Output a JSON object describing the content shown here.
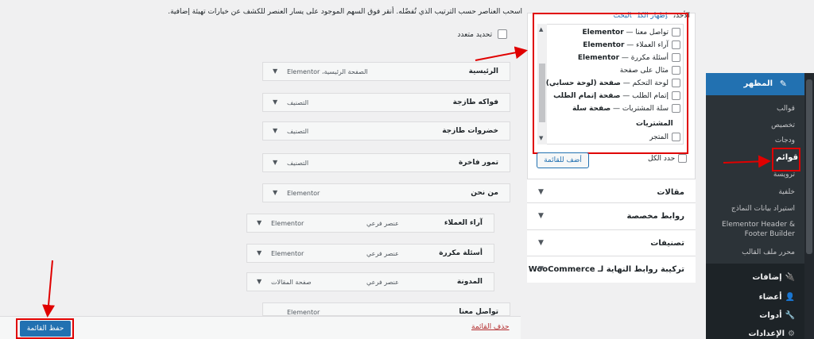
{
  "instructions": "اسحب العناصر حسب الترتيب الذي تُفضّله. أنقر فوق السهم الموجود على يسار العنصر للكشف عن خيارات تهيئة إضافية.",
  "bulk_select_label": "تحديد متعدد",
  "menu_items": [
    {
      "title": "الرئيسية",
      "type": "الصفحة الرئيسية، Elementor"
    },
    {
      "title": "فواكه طازجة",
      "type": "التصنيف"
    },
    {
      "title": "خضروات طازجة",
      "type": "التصنيف"
    },
    {
      "title": "تمور فاخرة",
      "type": "التصنيف"
    },
    {
      "title": "من نحن",
      "type": "Elementor"
    },
    {
      "title": "آراء العملاء",
      "subtag": "عنصر فرعي",
      "type": "Elementor"
    },
    {
      "title": "أسئلة مكررة",
      "subtag": "عنصر فرعي",
      "type": "Elementor"
    },
    {
      "title": "المدونة",
      "subtag": "عنصر فرعي",
      "type": "صفحة المقالات"
    },
    {
      "title": "تواصل معنا",
      "subtag": "",
      "type": "Elementor"
    }
  ],
  "footer": {
    "save_label": "حفظ القائمة",
    "delete_label": "حذف القائمة"
  },
  "add_panel": {
    "tabs": [
      "الأحدث",
      "إظهار الكل",
      "البحث"
    ],
    "pages_list": [
      {
        "name": "تواصل معنا",
        "suffix": "Elementor"
      },
      {
        "name": "آراء العملاء",
        "suffix": "Elementor"
      },
      {
        "name": "أسئلة مكررة",
        "suffix": "Elementor"
      },
      {
        "name": "مثال على صفحة",
        "suffix": ""
      },
      {
        "name": "لوحة التحكم",
        "suffix": "صفحة (لوحة حسابي)"
      },
      {
        "name": "إتمام الطلب",
        "suffix": "صفحة إتمام الطلب"
      },
      {
        "name": "سلة المشتريات",
        "suffix": "صفحة سلة"
      }
    ],
    "group_heading": "المشتريات",
    "last_item": "المتجر",
    "select_all": "حدد الكل",
    "add_button": "أضف للقائمة",
    "sections": [
      "مقالات",
      "روابط مخصصة",
      "تصنيفات",
      "تركيبة روابط النهاية لـ WooCommerce"
    ]
  },
  "sidebar": {
    "active": "المظهر",
    "submenu": [
      "قوالب",
      "تخصيص",
      "ودجات",
      "قوائم",
      "ترويسة",
      "خلفية",
      "استيراد بيانات النماذج",
      "Elementor Header & Footer Builder",
      "محرر ملف القالب"
    ],
    "current_sub": "قوائم",
    "main": [
      "إضافات",
      "أعضاء",
      "أدوات",
      "الإعدادات"
    ]
  },
  "colors": {
    "accent": "#2271b1",
    "highlight": "#e00000",
    "sidebar": "#1d2327"
  }
}
